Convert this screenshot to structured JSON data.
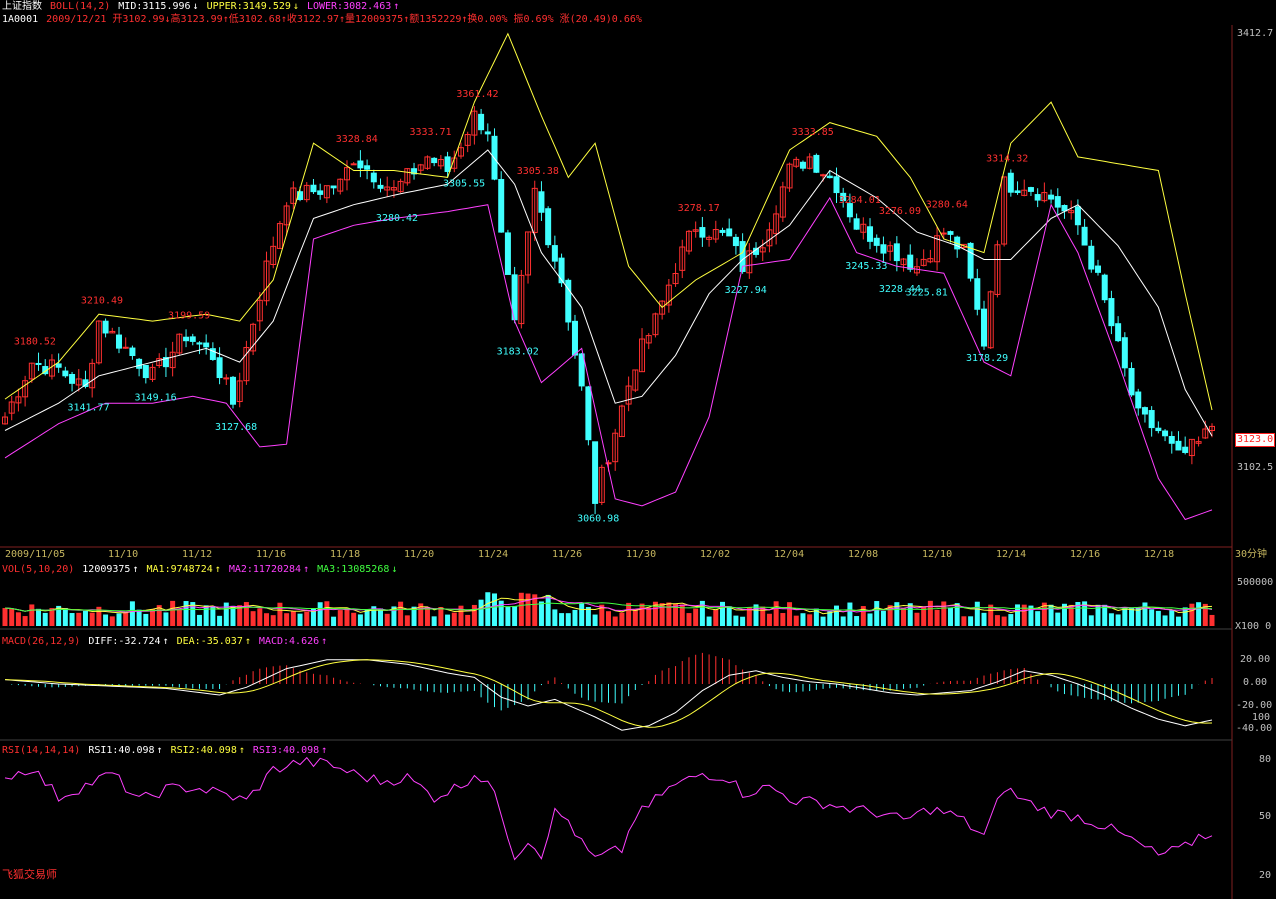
{
  "header": {
    "index_name": "上证指数",
    "boll_label": "BOLL(14,2)",
    "mid": "MID:3115.996",
    "mid_arrow": "↓",
    "upper": "UPPER:3149.529",
    "upper_arrow": "↓",
    "lower": "LOWER:3082.463",
    "lower_arrow": "↑",
    "code": "1A0001",
    "bar_info": "2009/12/21 开3102.99↓高3123.99↑低3102.68↑收3122.97↑量12009375↑额1352229↑换0.00% 振0.69% 涨(20.49)0.66%"
  },
  "vol_header": {
    "label": "VOL(5,10,20)",
    "vol": "12009375",
    "vol_arrow": "↑",
    "ma1": "MA1:9748724",
    "ma1_arrow": "↑",
    "ma2": "MA2:11720284",
    "ma2_arrow": "↑",
    "ma3": "MA3:13085268",
    "ma3_arrow": "↓"
  },
  "macd_header": {
    "label": "MACD(26,12,9)",
    "diff": "DIFF:-32.724",
    "diff_arrow": "↑",
    "dea": "DEA:-35.037",
    "dea_arrow": "↑",
    "macd": "MACD:4.626",
    "macd_arrow": "↑"
  },
  "rsi_header": {
    "label": "RSI(14,14,14)",
    "rsi1": "RSI1:40.098",
    "rsi1_arrow": "↑",
    "rsi2": "RSI2:40.098",
    "rsi2_arrow": "↑",
    "rsi3": "RSI3:40.098",
    "rsi3_arrow": "↑"
  },
  "price_axis": {
    "top": "3412.7",
    "bottom": "3102.5",
    "current": "3123.0"
  },
  "vol_axis": {
    "top": "500000",
    "bottom": "X100  0"
  },
  "macd_axis": [
    "20.00",
    "0.00",
    "-20.00",
    "100",
    "-40.00"
  ],
  "rsi_axis": [
    "80",
    "50",
    "20"
  ],
  "period": "30分钟",
  "brand": "飞狐交易师",
  "colors": {
    "up": "#ff3030",
    "down": "#40ffff",
    "mid": "#ffffff",
    "upper": "#ffff40",
    "lower": "#ff40ff",
    "grid": "#c8b860"
  },
  "chart_data": {
    "type": "candlestick",
    "x_dates": [
      "2009/11/05",
      "11/10",
      "11/12",
      "11/16",
      "11/18",
      "11/20",
      "11/24",
      "11/26",
      "11/30",
      "12/02",
      "12/04",
      "12/08",
      "12/10",
      "12/14",
      "12/16",
      "12/18"
    ],
    "ylim": [
      3040,
      3412.7
    ],
    "current_price": 3123.0,
    "annotations": [
      {
        "text": "3180.52",
        "price": 3180.52,
        "type": "high",
        "bar": 4
      },
      {
        "text": "3141.77",
        "price": 3141.77,
        "type": "low",
        "bar": 12
      },
      {
        "text": "3210.49",
        "price": 3210.49,
        "type": "high",
        "bar": 14
      },
      {
        "text": "3149.16",
        "price": 3149.16,
        "type": "low",
        "bar": 22
      },
      {
        "text": "3199.59",
        "price": 3199.59,
        "type": "high",
        "bar": 27
      },
      {
        "text": "3127.68",
        "price": 3127.68,
        "type": "low",
        "bar": 34
      },
      {
        "text": "3328.84",
        "price": 3328.84,
        "type": "high",
        "bar": 52
      },
      {
        "text": "3280.42",
        "price": 3280.42,
        "type": "low",
        "bar": 58
      },
      {
        "text": "3333.71",
        "price": 3333.71,
        "type": "high",
        "bar": 63
      },
      {
        "text": "3305.55",
        "price": 3305.55,
        "type": "low",
        "bar": 68
      },
      {
        "text": "3361.42",
        "price": 3361.42,
        "type": "high",
        "bar": 70
      },
      {
        "text": "3305.38",
        "price": 3305.38,
        "type": "high",
        "bar": 79
      },
      {
        "text": "3183.02",
        "price": 3183.02,
        "type": "low",
        "bar": 76
      },
      {
        "text": "3060.98",
        "price": 3060.98,
        "type": "low",
        "bar": 88
      },
      {
        "text": "3278.17",
        "price": 3278.17,
        "type": "high",
        "bar": 103
      },
      {
        "text": "3227.94",
        "price": 3227.94,
        "type": "low",
        "bar": 110
      },
      {
        "text": "3333.85",
        "price": 3333.85,
        "type": "high",
        "bar": 120
      },
      {
        "text": "3284.01",
        "price": 3284.01,
        "type": "high",
        "bar": 127
      },
      {
        "text": "3245.33",
        "price": 3245.33,
        "type": "low",
        "bar": 128
      },
      {
        "text": "3276.09",
        "price": 3276.09,
        "type": "high",
        "bar": 133
      },
      {
        "text": "3228.44",
        "price": 3228.44,
        "type": "low",
        "bar": 133
      },
      {
        "text": "3225.81",
        "price": 3225.81,
        "type": "low",
        "bar": 137
      },
      {
        "text": "3280.64",
        "price": 3280.64,
        "type": "high",
        "bar": 140
      },
      {
        "text": "3178.29",
        "price": 3178.29,
        "type": "low",
        "bar": 146
      },
      {
        "text": "3314.32",
        "price": 3314.32,
        "type": "high",
        "bar": 149
      }
    ],
    "close_anchors": [
      [
        0,
        3130
      ],
      [
        4,
        3170
      ],
      [
        8,
        3165
      ],
      [
        12,
        3150
      ],
      [
        14,
        3200
      ],
      [
        18,
        3180
      ],
      [
        22,
        3160
      ],
      [
        27,
        3190
      ],
      [
        31,
        3175
      ],
      [
        34,
        3140
      ],
      [
        36,
        3180
      ],
      [
        39,
        3240
      ],
      [
        42,
        3290
      ],
      [
        46,
        3295
      ],
      [
        50,
        3300
      ],
      [
        52,
        3320
      ],
      [
        58,
        3295
      ],
      [
        63,
        3320
      ],
      [
        66,
        3310
      ],
      [
        70,
        3350
      ],
      [
        72,
        3340
      ],
      [
        74,
        3260
      ],
      [
        76,
        3195
      ],
      [
        79,
        3295
      ],
      [
        83,
        3230
      ],
      [
        86,
        3150
      ],
      [
        88,
        3070
      ],
      [
        91,
        3120
      ],
      [
        94,
        3170
      ],
      [
        97,
        3200
      ],
      [
        100,
        3240
      ],
      [
        103,
        3270
      ],
      [
        108,
        3260
      ],
      [
        110,
        3240
      ],
      [
        113,
        3260
      ],
      [
        117,
        3310
      ],
      [
        120,
        3320
      ],
      [
        124,
        3300
      ],
      [
        127,
        3270
      ],
      [
        130,
        3260
      ],
      [
        133,
        3250
      ],
      [
        136,
        3240
      ],
      [
        140,
        3265
      ],
      [
        143,
        3250
      ],
      [
        146,
        3185
      ],
      [
        149,
        3300
      ],
      [
        152,
        3300
      ],
      [
        156,
        3290
      ],
      [
        160,
        3270
      ],
      [
        163,
        3230
      ],
      [
        166,
        3180
      ],
      [
        169,
        3130
      ],
      [
        172,
        3120
      ],
      [
        175,
        3100
      ],
      [
        178,
        3110
      ],
      [
        180,
        3123
      ]
    ],
    "upper_anchors": [
      [
        0,
        3143
      ],
      [
        8,
        3170
      ],
      [
        14,
        3205
      ],
      [
        22,
        3200
      ],
      [
        30,
        3205
      ],
      [
        35,
        3200
      ],
      [
        40,
        3230
      ],
      [
        46,
        3330
      ],
      [
        52,
        3310
      ],
      [
        58,
        3310
      ],
      [
        66,
        3305
      ],
      [
        70,
        3360
      ],
      [
        75,
        3410
      ],
      [
        80,
        3350
      ],
      [
        84,
        3305
      ],
      [
        88,
        3330
      ],
      [
        93,
        3240
      ],
      [
        98,
        3210
      ],
      [
        103,
        3230
      ],
      [
        110,
        3250
      ],
      [
        117,
        3325
      ],
      [
        123,
        3345
      ],
      [
        130,
        3335
      ],
      [
        135,
        3305
      ],
      [
        140,
        3260
      ],
      [
        146,
        3250
      ],
      [
        150,
        3330
      ],
      [
        156,
        3360
      ],
      [
        160,
        3320
      ],
      [
        166,
        3315
      ],
      [
        172,
        3310
      ],
      [
        176,
        3220
      ],
      [
        180,
        3135
      ]
    ],
    "lower_anchors": [
      [
        0,
        3100
      ],
      [
        8,
        3125
      ],
      [
        15,
        3140
      ],
      [
        22,
        3140
      ],
      [
        28,
        3145
      ],
      [
        33,
        3140
      ],
      [
        38,
        3108
      ],
      [
        42,
        3110
      ],
      [
        46,
        3260
      ],
      [
        52,
        3270
      ],
      [
        58,
        3275
      ],
      [
        66,
        3280
      ],
      [
        72,
        3285
      ],
      [
        76,
        3200
      ],
      [
        80,
        3155
      ],
      [
        86,
        3180
      ],
      [
        91,
        3070
      ],
      [
        95,
        3065
      ],
      [
        100,
        3075
      ],
      [
        105,
        3130
      ],
      [
        110,
        3240
      ],
      [
        117,
        3245
      ],
      [
        123,
        3290
      ],
      [
        127,
        3250
      ],
      [
        133,
        3240
      ],
      [
        140,
        3235
      ],
      [
        146,
        3170
      ],
      [
        150,
        3160
      ],
      [
        156,
        3285
      ],
      [
        160,
        3250
      ],
      [
        166,
        3170
      ],
      [
        172,
        3085
      ],
      [
        176,
        3055
      ],
      [
        180,
        3062
      ]
    ],
    "mid_anchors": [
      [
        0,
        3120
      ],
      [
        8,
        3140
      ],
      [
        14,
        3160
      ],
      [
        22,
        3170
      ],
      [
        30,
        3180
      ],
      [
        35,
        3170
      ],
      [
        40,
        3200
      ],
      [
        46,
        3275
      ],
      [
        52,
        3285
      ],
      [
        58,
        3292
      ],
      [
        66,
        3300
      ],
      [
        72,
        3325
      ],
      [
        76,
        3300
      ],
      [
        80,
        3250
      ],
      [
        86,
        3210
      ],
      [
        91,
        3140
      ],
      [
        95,
        3145
      ],
      [
        100,
        3175
      ],
      [
        105,
        3220
      ],
      [
        110,
        3245
      ],
      [
        117,
        3270
      ],
      [
        123,
        3310
      ],
      [
        130,
        3290
      ],
      [
        136,
        3265
      ],
      [
        142,
        3255
      ],
      [
        146,
        3245
      ],
      [
        150,
        3245
      ],
      [
        156,
        3275
      ],
      [
        160,
        3285
      ],
      [
        166,
        3255
      ],
      [
        172,
        3210
      ],
      [
        176,
        3150
      ],
      [
        180,
        3115.996
      ]
    ],
    "macd_anchors": [
      [
        0,
        4
      ],
      [
        8,
        0
      ],
      [
        16,
        -2
      ],
      [
        24,
        -4
      ],
      [
        32,
        -10
      ],
      [
        36,
        -3
      ],
      [
        42,
        14
      ],
      [
        48,
        22
      ],
      [
        54,
        22
      ],
      [
        60,
        18
      ],
      [
        66,
        10
      ],
      [
        70,
        6
      ],
      [
        74,
        -12
      ],
      [
        78,
        -20
      ],
      [
        82,
        -14
      ],
      [
        88,
        -30
      ],
      [
        92,
        -42
      ],
      [
        96,
        -38
      ],
      [
        100,
        -26
      ],
      [
        104,
        -6
      ],
      [
        108,
        8
      ],
      [
        112,
        12
      ],
      [
        116,
        6
      ],
      [
        120,
        2
      ],
      [
        124,
        0
      ],
      [
        128,
        -4
      ],
      [
        132,
        -8
      ],
      [
        136,
        -10
      ],
      [
        140,
        -8
      ],
      [
        144,
        -6
      ],
      [
        148,
        2
      ],
      [
        152,
        12
      ],
      [
        156,
        8
      ],
      [
        160,
        0
      ],
      [
        164,
        -10
      ],
      [
        168,
        -22
      ],
      [
        172,
        -32
      ],
      [
        176,
        -38
      ],
      [
        180,
        -32.724
      ]
    ],
    "rsi_anchors": [
      [
        0,
        70
      ],
      [
        4,
        75
      ],
      [
        8,
        60
      ],
      [
        12,
        66
      ],
      [
        16,
        72
      ],
      [
        20,
        58
      ],
      [
        24,
        64
      ],
      [
        28,
        65
      ],
      [
        32,
        62
      ],
      [
        36,
        58
      ],
      [
        40,
        74
      ],
      [
        44,
        78
      ],
      [
        48,
        77
      ],
      [
        52,
        72
      ],
      [
        56,
        68
      ],
      [
        60,
        70
      ],
      [
        64,
        60
      ],
      [
        68,
        66
      ],
      [
        70,
        72
      ],
      [
        72,
        68
      ],
      [
        74,
        52
      ],
      [
        76,
        30
      ],
      [
        78,
        38
      ],
      [
        80,
        31
      ],
      [
        82,
        52
      ],
      [
        84,
        48
      ],
      [
        86,
        36
      ],
      [
        88,
        28
      ],
      [
        90,
        31
      ],
      [
        92,
        33
      ],
      [
        94,
        50
      ],
      [
        96,
        55
      ],
      [
        98,
        62
      ],
      [
        100,
        66
      ],
      [
        104,
        72
      ],
      [
        108,
        70
      ],
      [
        110,
        62
      ],
      [
        114,
        65
      ],
      [
        118,
        58
      ],
      [
        122,
        57
      ],
      [
        126,
        54
      ],
      [
        130,
        52
      ],
      [
        134,
        48
      ],
      [
        138,
        54
      ],
      [
        142,
        50
      ],
      [
        146,
        40
      ],
      [
        149,
        65
      ],
      [
        152,
        58
      ],
      [
        156,
        52
      ],
      [
        160,
        50
      ],
      [
        164,
        45
      ],
      [
        168,
        38
      ],
      [
        172,
        30
      ],
      [
        176,
        34
      ],
      [
        178,
        40
      ],
      [
        180,
        40.098
      ]
    ],
    "volume_scale_max": 500000
  }
}
